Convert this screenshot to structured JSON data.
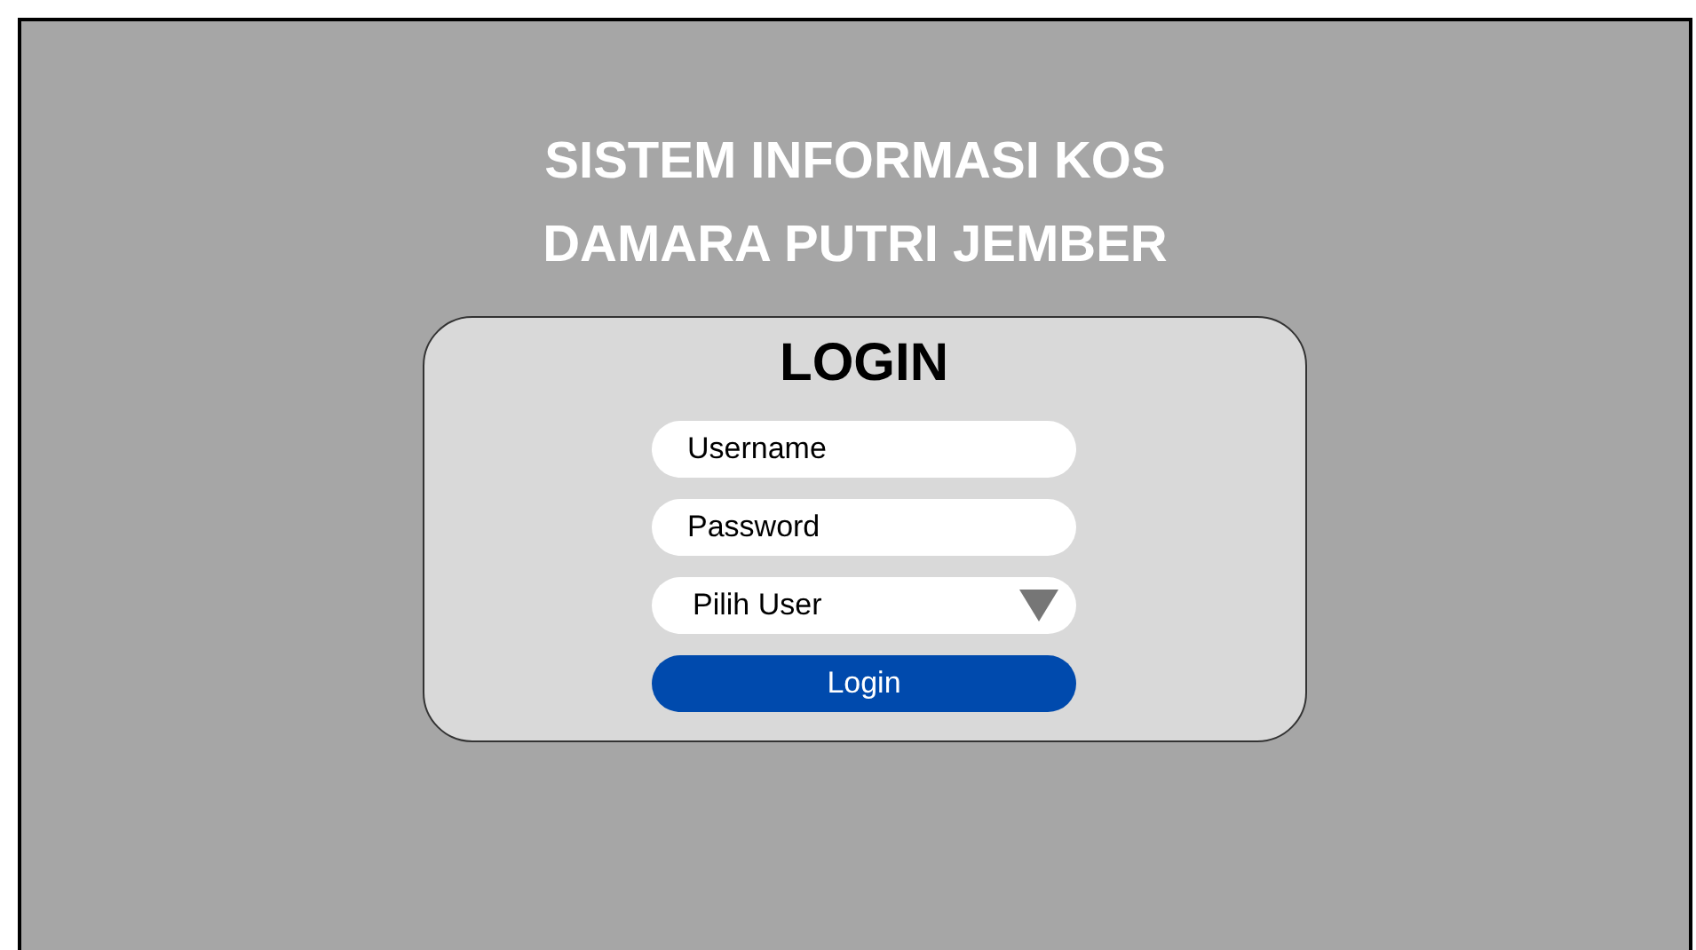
{
  "title_lines": [
    "SISTEM INFORMASI KOS",
    "DAMARA PUTRI JEMBER"
  ],
  "login": {
    "heading": "LOGIN",
    "fields": [
      {
        "kind": "text",
        "placeholder": "Username"
      },
      {
        "kind": "password",
        "placeholder": "Password"
      },
      {
        "kind": "select",
        "value": "Pilih User"
      }
    ],
    "button": "Login"
  }
}
